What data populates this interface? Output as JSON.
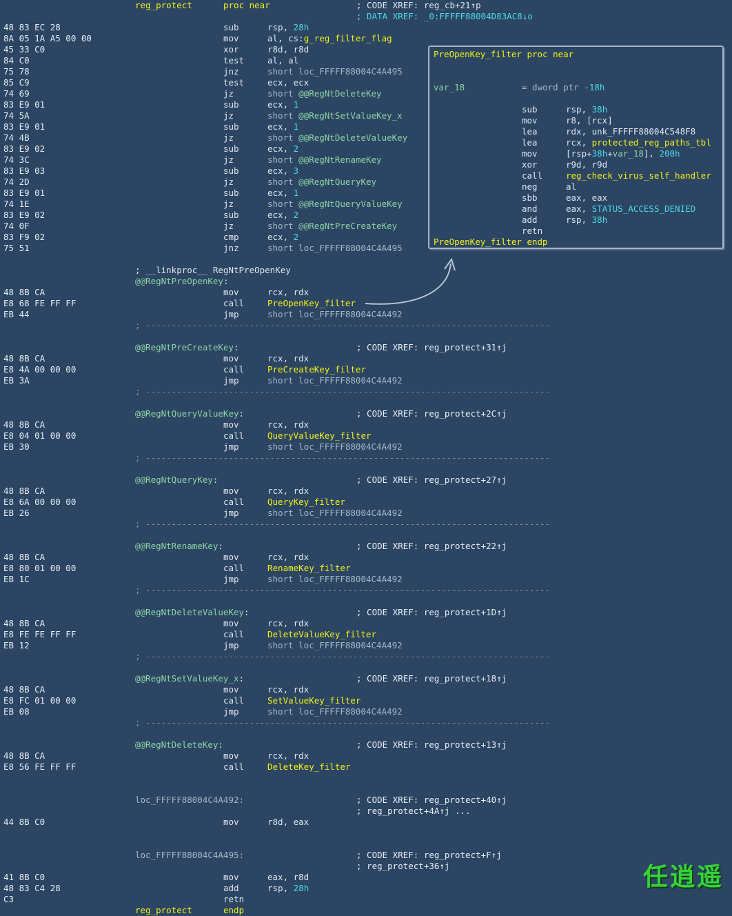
{
  "header": {
    "label": "reg_protect",
    "mnem": "proc near",
    "comments": [
      [
        {
          "t": "; CODE XREF: reg_cb+21↑p",
          "c": "w"
        }
      ],
      [
        {
          "t": "; DATA XREF: _0:FFFFF88004D83AC8↓o",
          "c": "cy"
        }
      ]
    ]
  },
  "instructions": [
    {
      "bytes": "48 83 EC 28",
      "mnem": "sub",
      "ops": [
        {
          "t": "rsp, ",
          "c": "w"
        },
        {
          "t": "28h",
          "c": "cy"
        }
      ]
    },
    {
      "bytes": "8A 05 1A A5 00 00",
      "mnem": "mov",
      "ops": [
        {
          "t": "al, cs:",
          "c": "w"
        },
        {
          "t": "g_reg_filter_flag",
          "c": "y"
        }
      ]
    },
    {
      "bytes": "45 33 C0",
      "mnem": "xor",
      "ops": [
        {
          "t": "r8d, r8d",
          "c": "w"
        }
      ]
    },
    {
      "bytes": "84 C0",
      "mnem": "test",
      "ops": [
        {
          "t": "al, al",
          "c": "w"
        }
      ]
    },
    {
      "bytes": "75 78",
      "mnem": "jnz",
      "ops": [
        {
          "t": "short loc_FFFFF88004C4A495",
          "c": "gr"
        }
      ]
    },
    {
      "bytes": "85 C9",
      "mnem": "test",
      "ops": [
        {
          "t": "ecx, ecx",
          "c": "w"
        }
      ]
    },
    {
      "bytes": "74 69",
      "mnem": "jz",
      "ops": [
        {
          "t": "short ",
          "c": "gr"
        },
        {
          "t": "@@RegNtDeleteKey",
          "c": "g"
        }
      ]
    },
    {
      "bytes": "83 E9 01",
      "mnem": "sub",
      "ops": [
        {
          "t": "ecx, ",
          "c": "w"
        },
        {
          "t": "1",
          "c": "cy"
        }
      ]
    },
    {
      "bytes": "74 5A",
      "mnem": "jz",
      "ops": [
        {
          "t": "short ",
          "c": "gr"
        },
        {
          "t": "@@RegNtSetValueKey_x",
          "c": "g"
        }
      ]
    },
    {
      "bytes": "83 E9 01",
      "mnem": "sub",
      "ops": [
        {
          "t": "ecx, ",
          "c": "w"
        },
        {
          "t": "1",
          "c": "cy"
        }
      ]
    },
    {
      "bytes": "74 4B",
      "mnem": "jz",
      "ops": [
        {
          "t": "short ",
          "c": "gr"
        },
        {
          "t": "@@RegNtDeleteValueKey",
          "c": "g"
        }
      ]
    },
    {
      "bytes": "83 E9 02",
      "mnem": "sub",
      "ops": [
        {
          "t": "ecx, ",
          "c": "w"
        },
        {
          "t": "2",
          "c": "cy"
        }
      ]
    },
    {
      "bytes": "74 3C",
      "mnem": "jz",
      "ops": [
        {
          "t": "short ",
          "c": "gr"
        },
        {
          "t": "@@RegNtRenameKey",
          "c": "g"
        }
      ]
    },
    {
      "bytes": "83 E9 03",
      "mnem": "sub",
      "ops": [
        {
          "t": "ecx, ",
          "c": "w"
        },
        {
          "t": "3",
          "c": "cy"
        }
      ]
    },
    {
      "bytes": "74 2D",
      "mnem": "jz",
      "ops": [
        {
          "t": "short ",
          "c": "gr"
        },
        {
          "t": "@@RegNtQueryKey",
          "c": "g"
        }
      ]
    },
    {
      "bytes": "83 E9 01",
      "mnem": "sub",
      "ops": [
        {
          "t": "ecx, ",
          "c": "w"
        },
        {
          "t": "1",
          "c": "cy"
        }
      ]
    },
    {
      "bytes": "74 1E",
      "mnem": "jz",
      "ops": [
        {
          "t": "short ",
          "c": "gr"
        },
        {
          "t": "@@RegNtQueryValueKey",
          "c": "g"
        }
      ]
    },
    {
      "bytes": "83 E9 02",
      "mnem": "sub",
      "ops": [
        {
          "t": "ecx, ",
          "c": "w"
        },
        {
          "t": "2",
          "c": "cy"
        }
      ]
    },
    {
      "bytes": "74 0F",
      "mnem": "jz",
      "ops": [
        {
          "t": "short ",
          "c": "gr"
        },
        {
          "t": "@@RegNtPreCreateKey",
          "c": "g"
        }
      ]
    },
    {
      "bytes": "83 F9 02",
      "mnem": "cmp",
      "ops": [
        {
          "t": "ecx, ",
          "c": "w"
        },
        {
          "t": "2",
          "c": "cy"
        }
      ]
    },
    {
      "bytes": "75 51",
      "mnem": "jnz",
      "ops": [
        {
          "t": "short loc_FFFFF88004C4A495",
          "c": "gr"
        }
      ]
    },
    {
      "gap": true
    },
    {
      "label": [
        {
          "t": "; __linkproc__ RegNtPreOpenKey",
          "c": "w"
        }
      ]
    },
    {
      "label": [
        {
          "t": "@@RegNtPreOpenKey",
          "c": "g"
        },
        {
          "t": ":",
          "c": "w"
        }
      ]
    },
    {
      "bytes": "48 8B CA",
      "mnem": "mov",
      "ops": [
        {
          "t": "rcx, rdx",
          "c": "w"
        }
      ]
    },
    {
      "bytes": "E8 68 FE FF FF",
      "mnem": "call",
      "ops": [
        {
          "t": "PreOpenKey_filter",
          "c": "y"
        }
      ]
    },
    {
      "bytes": "EB 44",
      "mnem": "jmp",
      "ops": [
        {
          "t": "short loc_FFFFF88004C4A492",
          "c": "gr"
        }
      ]
    },
    {
      "sep": true
    },
    {
      "gap": true
    },
    {
      "label": [
        {
          "t": "@@RegNtPreCreateKey",
          "c": "g"
        },
        {
          "t": ":",
          "c": "w"
        }
      ],
      "comment": "; CODE XREF: reg_protect+31↑j"
    },
    {
      "bytes": "48 8B CA",
      "mnem": "mov",
      "ops": [
        {
          "t": "rcx, rdx",
          "c": "w"
        }
      ]
    },
    {
      "bytes": "E8 4A 00 00 00",
      "mnem": "call",
      "ops": [
        {
          "t": "PreCreateKey_filter",
          "c": "y"
        }
      ]
    },
    {
      "bytes": "EB 3A",
      "mnem": "jmp",
      "ops": [
        {
          "t": "short loc_FFFFF88004C4A492",
          "c": "gr"
        }
      ]
    },
    {
      "sep": true
    },
    {
      "gap": true
    },
    {
      "label": [
        {
          "t": "@@RegNtQueryValueKey",
          "c": "g"
        },
        {
          "t": ":",
          "c": "w"
        }
      ],
      "comment": "; CODE XREF: reg_protect+2C↑j"
    },
    {
      "bytes": "48 8B CA",
      "mnem": "mov",
      "ops": [
        {
          "t": "rcx, rdx",
          "c": "w"
        }
      ]
    },
    {
      "bytes": "E8 04 01 00 00",
      "mnem": "call",
      "ops": [
        {
          "t": "QueryValueKey_filter",
          "c": "y"
        }
      ]
    },
    {
      "bytes": "EB 30",
      "mnem": "jmp",
      "ops": [
        {
          "t": "short loc_FFFFF88004C4A492",
          "c": "gr"
        }
      ]
    },
    {
      "sep": true
    },
    {
      "gap": true
    },
    {
      "label": [
        {
          "t": "@@RegNtQueryKey",
          "c": "g"
        },
        {
          "t": ":",
          "c": "w"
        }
      ],
      "comment": "; CODE XREF: reg_protect+27↑j"
    },
    {
      "bytes": "48 8B CA",
      "mnem": "mov",
      "ops": [
        {
          "t": "rcx, rdx",
          "c": "w"
        }
      ]
    },
    {
      "bytes": "E8 6A 00 00 00",
      "mnem": "call",
      "ops": [
        {
          "t": "QueryKey_filter",
          "c": "y"
        }
      ]
    },
    {
      "bytes": "EB 26",
      "mnem": "jmp",
      "ops": [
        {
          "t": "short loc_FFFFF88004C4A492",
          "c": "gr"
        }
      ]
    },
    {
      "sep": true
    },
    {
      "gap": true
    },
    {
      "label": [
        {
          "t": "@@RegNtRenameKey",
          "c": "g"
        },
        {
          "t": ":",
          "c": "w"
        }
      ],
      "comment": "; CODE XREF: reg_protect+22↑j"
    },
    {
      "bytes": "48 8B CA",
      "mnem": "mov",
      "ops": [
        {
          "t": "rcx, rdx",
          "c": "w"
        }
      ]
    },
    {
      "bytes": "E8 80 01 00 00",
      "mnem": "call",
      "ops": [
        {
          "t": "RenameKey_filter",
          "c": "y"
        }
      ]
    },
    {
      "bytes": "EB 1C",
      "mnem": "jmp",
      "ops": [
        {
          "t": "short loc_FFFFF88004C4A492",
          "c": "gr"
        }
      ]
    },
    {
      "sep": true
    },
    {
      "gap": true
    },
    {
      "label": [
        {
          "t": "@@RegNtDeleteValueKey",
          "c": "g"
        },
        {
          "t": ":",
          "c": "w"
        }
      ],
      "comment": "; CODE XREF: reg_protect+1D↑j"
    },
    {
      "bytes": "48 8B CA",
      "mnem": "mov",
      "ops": [
        {
          "t": "rcx, rdx",
          "c": "w"
        }
      ]
    },
    {
      "bytes": "E8 FE FE FF FF",
      "mnem": "call",
      "ops": [
        {
          "t": "DeleteValueKey_filter",
          "c": "y"
        }
      ]
    },
    {
      "bytes": "EB 12",
      "mnem": "jmp",
      "ops": [
        {
          "t": "short loc_FFFFF88004C4A492",
          "c": "gr"
        }
      ]
    },
    {
      "sep": true
    },
    {
      "gap": true
    },
    {
      "label": [
        {
          "t": "@@RegNtSetValueKey_x",
          "c": "g"
        },
        {
          "t": ":",
          "c": "w"
        }
      ],
      "comment": "; CODE XREF: reg_protect+18↑j"
    },
    {
      "bytes": "48 8B CA",
      "mnem": "mov",
      "ops": [
        {
          "t": "rcx, rdx",
          "c": "w"
        }
      ]
    },
    {
      "bytes": "E8 FC 01 00 00",
      "mnem": "call",
      "ops": [
        {
          "t": "SetValueKey_filter",
          "c": "y"
        }
      ]
    },
    {
      "bytes": "EB 08",
      "mnem": "jmp",
      "ops": [
        {
          "t": "short loc_FFFFF88004C4A492",
          "c": "gr"
        }
      ]
    },
    {
      "sep": true
    },
    {
      "gap": true
    },
    {
      "label": [
        {
          "t": "@@RegNtDeleteKey",
          "c": "g"
        },
        {
          "t": ":",
          "c": "w"
        }
      ],
      "comment": "; CODE XREF: reg_protect+13↑j"
    },
    {
      "bytes": "48 8B CA",
      "mnem": "mov",
      "ops": [
        {
          "t": "rcx, rdx",
          "c": "w"
        }
      ]
    },
    {
      "bytes": "E8 56 FE FF FF",
      "mnem": "call",
      "ops": [
        {
          "t": "DeleteKey_filter",
          "c": "y"
        }
      ]
    },
    {
      "gap": true
    },
    {
      "gap": true
    },
    {
      "label": [
        {
          "t": "loc_FFFFF88004C4A492:",
          "c": "gr"
        }
      ],
      "comment": "; CODE XREF: reg_protect+40↑j"
    },
    {
      "comment": "; reg_protect+4A↑j ..."
    },
    {
      "bytes": "44 8B C0",
      "mnem": "mov",
      "ops": [
        {
          "t": "r8d, eax",
          "c": "w"
        }
      ]
    },
    {
      "gap": true
    },
    {
      "gap": true
    },
    {
      "label": [
        {
          "t": "loc_FFFFF88004C4A495:",
          "c": "gr"
        }
      ],
      "comment": "; CODE XREF: reg_protect+F↑j"
    },
    {
      "comment": "; reg_protect+36↑j"
    },
    {
      "bytes": "41 8B C0",
      "mnem": "mov",
      "ops": [
        {
          "t": "eax, r8d",
          "c": "w"
        }
      ]
    },
    {
      "bytes": "48 83 C4 28",
      "mnem": "add",
      "ops": [
        {
          "t": "rsp, ",
          "c": "w"
        },
        {
          "t": "28h",
          "c": "cy"
        }
      ]
    },
    {
      "bytes": "C3",
      "mnem": "retn",
      "ops": []
    }
  ],
  "footer": {
    "label": "reg_protect",
    "mnem": "endp"
  },
  "separator_text": "; ------------------------------------------------------------------------------",
  "popup": {
    "rows": [
      {
        "label": [
          {
            "t": "PreOpenKey_filter proc near",
            "c": "y"
          }
        ]
      },
      {
        "gap": true
      },
      {
        "gap": true
      },
      {
        "label": [
          {
            "t": "var_18",
            "c": "g"
          }
        ],
        "mnem": "= dword ptr -",
        "ops": [
          {
            "t": "18h",
            "c": "cy"
          }
        ],
        "mnemSplit": true
      },
      {
        "gap": true
      },
      {
        "mnem": "sub",
        "ops": [
          {
            "t": "rsp, ",
            "c": "w"
          },
          {
            "t": "38h",
            "c": "cy"
          }
        ]
      },
      {
        "mnem": "mov",
        "ops": [
          {
            "t": "r8, [rcx]",
            "c": "w"
          }
        ]
      },
      {
        "mnem": "lea",
        "ops": [
          {
            "t": "rdx, unk_FFFFF88004C548F8",
            "c": "w"
          }
        ]
      },
      {
        "mnem": "lea",
        "ops": [
          {
            "t": "rcx, ",
            "c": "w"
          },
          {
            "t": "protected_reg_paths_tbl",
            "c": "y"
          }
        ]
      },
      {
        "mnem": "mov",
        "ops": [
          {
            "t": "[rsp+",
            "c": "w"
          },
          {
            "t": "38h",
            "c": "cy"
          },
          {
            "t": "+",
            "c": "w"
          },
          {
            "t": "var_18",
            "c": "g"
          },
          {
            "t": "], ",
            "c": "w"
          },
          {
            "t": "200h",
            "c": "cy"
          }
        ]
      },
      {
        "mnem": "xor",
        "ops": [
          {
            "t": "r9d, r9d",
            "c": "w"
          }
        ]
      },
      {
        "mnem": "call",
        "ops": [
          {
            "t": "reg_check_virus_self_handler",
            "c": "y"
          }
        ]
      },
      {
        "mnem": "neg",
        "ops": [
          {
            "t": "al",
            "c": "w"
          }
        ]
      },
      {
        "mnem": "sbb",
        "ops": [
          {
            "t": "eax, eax",
            "c": "w"
          }
        ]
      },
      {
        "mnem": "and",
        "ops": [
          {
            "t": "eax, ",
            "c": "w"
          },
          {
            "t": "STATUS_ACCESS_DENIED",
            "c": "cy"
          }
        ]
      },
      {
        "mnem": "add",
        "ops": [
          {
            "t": "rsp, ",
            "c": "w"
          },
          {
            "t": "38h",
            "c": "cy"
          }
        ]
      },
      {
        "mnem": "retn",
        "ops": []
      },
      {
        "label": [
          {
            "t": "PreOpenKey_filter endp",
            "c": "y"
          }
        ]
      }
    ]
  },
  "watermark": "任逍遥",
  "colors": {
    "background": "#2b4563",
    "name_yellow": "#f2f21a",
    "label_green": "#8ed4a6",
    "number_cyan": "#4fd9e6",
    "text": "#dfe6ee",
    "watermark_green": "#36d23a"
  }
}
